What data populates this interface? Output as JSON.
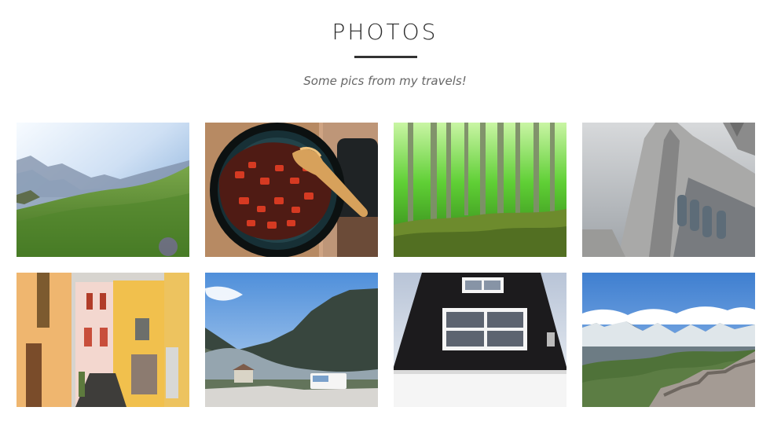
{
  "header": {
    "title": "PHOTOS",
    "subtitle": "Some pics from my travels!"
  },
  "gallery": {
    "images": [
      {
        "kind": "mountain-meadow"
      },
      {
        "kind": "frying-pan-food"
      },
      {
        "kind": "green-forest"
      },
      {
        "kind": "gothic-church-tower"
      },
      {
        "kind": "narrow-street-houses"
      },
      {
        "kind": "fjord-campsite"
      },
      {
        "kind": "dark-tall-building"
      },
      {
        "kind": "snowy-mountain-panorama"
      }
    ]
  },
  "colors": {
    "title": "#2b2b2b",
    "underline": "#333333",
    "subtitle": "#666666",
    "background": "#ffffff"
  }
}
